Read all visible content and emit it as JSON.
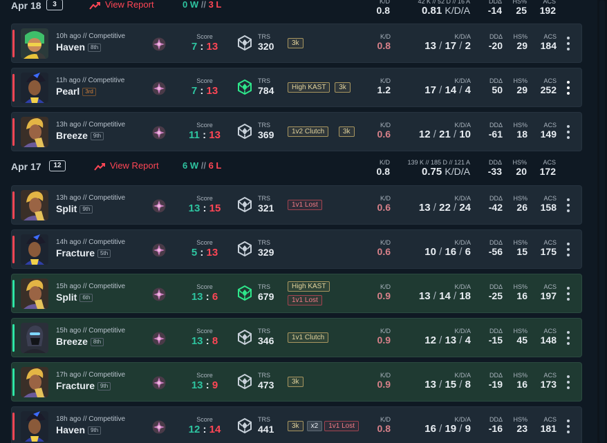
{
  "days": [
    {
      "date": "Apr 18",
      "count": "3",
      "report_label": "View Report",
      "wins": "0 W",
      "sep": " // ",
      "losses": "3 L",
      "summary": {
        "kd_label": "K/D",
        "kd": "0.8",
        "totals": "42 K // 52 D // 16 A",
        "kda": "0.81",
        "kda_unit": "K/D/A",
        "dda_label": "DDΔ",
        "dda": "-14",
        "hs_label": "HS%",
        "hs": "25",
        "acs_label": "ACS",
        "acs": "192"
      }
    },
    {
      "date": "Apr 17",
      "count": "12",
      "report_label": "View Report",
      "wins": "6 W",
      "sep": " // ",
      "losses": "6 L",
      "summary": {
        "kd_label": "K/D",
        "kd": "0.8",
        "totals": "139 K // 185 D // 121 A",
        "kda": "0.75",
        "kda_unit": "K/D/A",
        "dda_label": "DDΔ",
        "dda": "-33",
        "hs_label": "HS%",
        "hs": "20",
        "acs_label": "ACS",
        "acs": "172"
      }
    }
  ],
  "labels": {
    "score": "Score",
    "trs": "TRS",
    "kd": "K/D",
    "kda": "K/D/A",
    "dda": "DDΔ",
    "hs": "HS%",
    "acs": "ACS"
  },
  "matches": [
    {
      "agent": "gekko",
      "when": "10h ago // Competitive",
      "map": "Haven",
      "place": "8th",
      "result": "loss",
      "score_a": "7",
      "score_b": "13",
      "trs": "320",
      "trs_tier": "grey",
      "badges": [
        {
          "text": "3k",
          "style": "gold"
        }
      ],
      "kd": "0.8",
      "k": "13",
      "d": "17",
      "a": "2",
      "dda": "-20",
      "hs": "29",
      "acs": "184"
    },
    {
      "agent": "neon",
      "when": "11h ago // Competitive",
      "map": "Pearl",
      "place": "3rd",
      "place_top": true,
      "result": "loss",
      "score_a": "7",
      "score_b": "13",
      "trs": "784",
      "trs_tier": "green",
      "badges": [
        {
          "text": "High KAST",
          "style": "gold"
        },
        {
          "text": "3k",
          "style": "gold"
        }
      ],
      "kd": "1.2",
      "k": "17",
      "d": "14",
      "a": "4",
      "dda": "50",
      "hs": "29",
      "acs": "252",
      "menu_active": true
    },
    {
      "agent": "phoenix",
      "when": "13h ago // Competitive",
      "map": "Breeze",
      "place": "9th",
      "result": "loss",
      "score_a": "11",
      "score_b": "13",
      "trs": "369",
      "trs_tier": "grey",
      "badges": [
        {
          "text": "1v2 Clutch",
          "style": "gold"
        },
        {
          "text": "3k",
          "style": "gold"
        }
      ],
      "kd": "0.6",
      "k": "12",
      "d": "21",
      "a": "10",
      "dda": "-61",
      "hs": "18",
      "acs": "149"
    },
    {
      "agent": "phoenix",
      "when": "13h ago // Competitive",
      "map": "Split",
      "place": "9th",
      "result": "loss",
      "score_a": "13",
      "score_b": "15",
      "trs": "321",
      "trs_tier": "grey",
      "badges": [
        {
          "text": "1v1 Lost",
          "style": "red"
        }
      ],
      "kd": "0.6",
      "k": "13",
      "d": "22",
      "a": "24",
      "dda": "-42",
      "hs": "26",
      "acs": "158"
    },
    {
      "agent": "neon",
      "when": "14h ago // Competitive",
      "map": "Fracture",
      "place": "5th",
      "result": "loss",
      "score_a": "5",
      "score_b": "13",
      "trs": "329",
      "trs_tier": "grey",
      "badges": [],
      "kd": "0.6",
      "k": "10",
      "d": "16",
      "a": "6",
      "dda": "-56",
      "hs": "15",
      "acs": "175"
    },
    {
      "agent": "phoenix",
      "when": "15h ago // Competitive",
      "map": "Split",
      "place": "6th",
      "result": "win",
      "score_a": "13",
      "score_b": "6",
      "trs": "679",
      "trs_tier": "green",
      "badges": [
        {
          "text": "High KAST",
          "style": "gold"
        },
        {
          "text": "1v1 Lost",
          "style": "red"
        }
      ],
      "kd": "0.9",
      "k": "13",
      "d": "14",
      "a": "18",
      "dda": "-25",
      "hs": "16",
      "acs": "197"
    },
    {
      "agent": "omen",
      "when": "15h ago // Competitive",
      "map": "Breeze",
      "place": "8th",
      "result": "win",
      "score_a": "13",
      "score_b": "8",
      "trs": "346",
      "trs_tier": "grey",
      "badges": [
        {
          "text": "1v1 Clutch",
          "style": "gold"
        }
      ],
      "kd": "0.9",
      "k": "12",
      "d": "13",
      "a": "4",
      "dda": "-15",
      "hs": "45",
      "acs": "148"
    },
    {
      "agent": "phoenix",
      "when": "17h ago // Competitive",
      "map": "Fracture",
      "place": "9th",
      "result": "win",
      "score_a": "13",
      "score_b": "9",
      "trs": "473",
      "trs_tier": "grey",
      "badges": [
        {
          "text": "3k",
          "style": "gold"
        }
      ],
      "kd": "0.9",
      "k": "13",
      "d": "15",
      "a": "8",
      "dda": "-19",
      "hs": "16",
      "acs": "173"
    },
    {
      "agent": "neon",
      "when": "18h ago // Competitive",
      "map": "Haven",
      "place": "9th",
      "result": "loss",
      "score_a": "12",
      "score_b": "14",
      "trs": "441",
      "trs_tier": "grey",
      "badges": [
        {
          "text": "3k",
          "style": "gold"
        },
        {
          "text": "x2",
          "style": "grey"
        },
        {
          "text": "1v1 Lost",
          "style": "red"
        }
      ],
      "kd": "0.8",
      "k": "16",
      "d": "19",
      "a": "9",
      "dda": "-16",
      "hs": "23",
      "acs": "181"
    }
  ],
  "colors": {
    "bg": "#0f1923",
    "row": "#1e2a35",
    "row_win": "#1f3a32",
    "loss": "#ff4655",
    "win": "#2ec4a0",
    "badge_gold": "#e2d39c"
  }
}
